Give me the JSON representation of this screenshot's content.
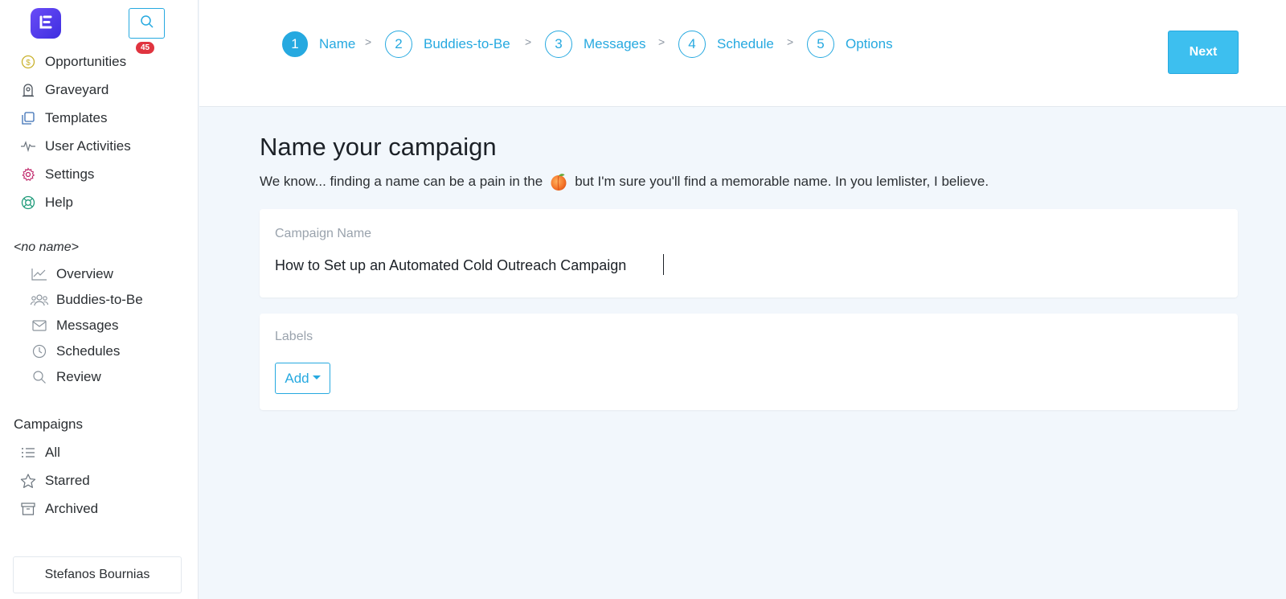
{
  "sidebar": {
    "logo_icon": "lemlist-logo-icon",
    "search_icon": "search-icon",
    "main_nav": [
      {
        "label": "Opportunities",
        "icon": "dollar-coin-icon",
        "badge": "45"
      },
      {
        "label": "Graveyard",
        "icon": "tombstone-icon"
      },
      {
        "label": "Templates",
        "icon": "copy-icon"
      },
      {
        "label": "User Activities",
        "icon": "pulse-icon"
      },
      {
        "label": "Settings",
        "icon": "gear-icon"
      },
      {
        "label": "Help",
        "icon": "lifebuoy-icon"
      }
    ],
    "campaign_section_title": "<no name>",
    "campaign_nav": [
      {
        "label": "Overview",
        "icon": "chart-line-icon"
      },
      {
        "label": "Buddies-to-Be",
        "icon": "users-icon"
      },
      {
        "label": "Messages",
        "icon": "envelope-icon"
      },
      {
        "label": "Schedules",
        "icon": "clock-icon"
      },
      {
        "label": "Review",
        "icon": "magnifier-icon"
      }
    ],
    "campaigns_title": "Campaigns",
    "campaigns_nav": [
      {
        "label": "All",
        "icon": "list-icon"
      },
      {
        "label": "Starred",
        "icon": "star-icon"
      },
      {
        "label": "Archived",
        "icon": "archive-box-icon"
      }
    ],
    "user_name": "Stefanos Bournias"
  },
  "steps": [
    {
      "number": "1",
      "label": "Name",
      "active": true
    },
    {
      "number": "2",
      "label": "Buddies-to-Be"
    },
    {
      "number": "3",
      "label": "Messages"
    },
    {
      "number": "4",
      "label": "Schedule"
    },
    {
      "number": "5",
      "label": "Options"
    }
  ],
  "step_separator": ">",
  "next_label": "Next",
  "main": {
    "title": "Name your campaign",
    "subtitle_before": "We know... finding a name can be a pain in the",
    "subtitle_emoji": "peach-emoji-icon",
    "subtitle_after": "but I'm sure you'll find a memorable name. In you lemlister, I believe.",
    "campaign_name_label": "Campaign Name",
    "campaign_name_value": "How to Set up an Automated Cold Outreach Campaign",
    "labels_label": "Labels",
    "add_label": "Add"
  },
  "colors": {
    "accent": "#26a9e0",
    "next_button": "#3dbfef",
    "badge": "#e0343f",
    "background": "#f2f7fc"
  }
}
